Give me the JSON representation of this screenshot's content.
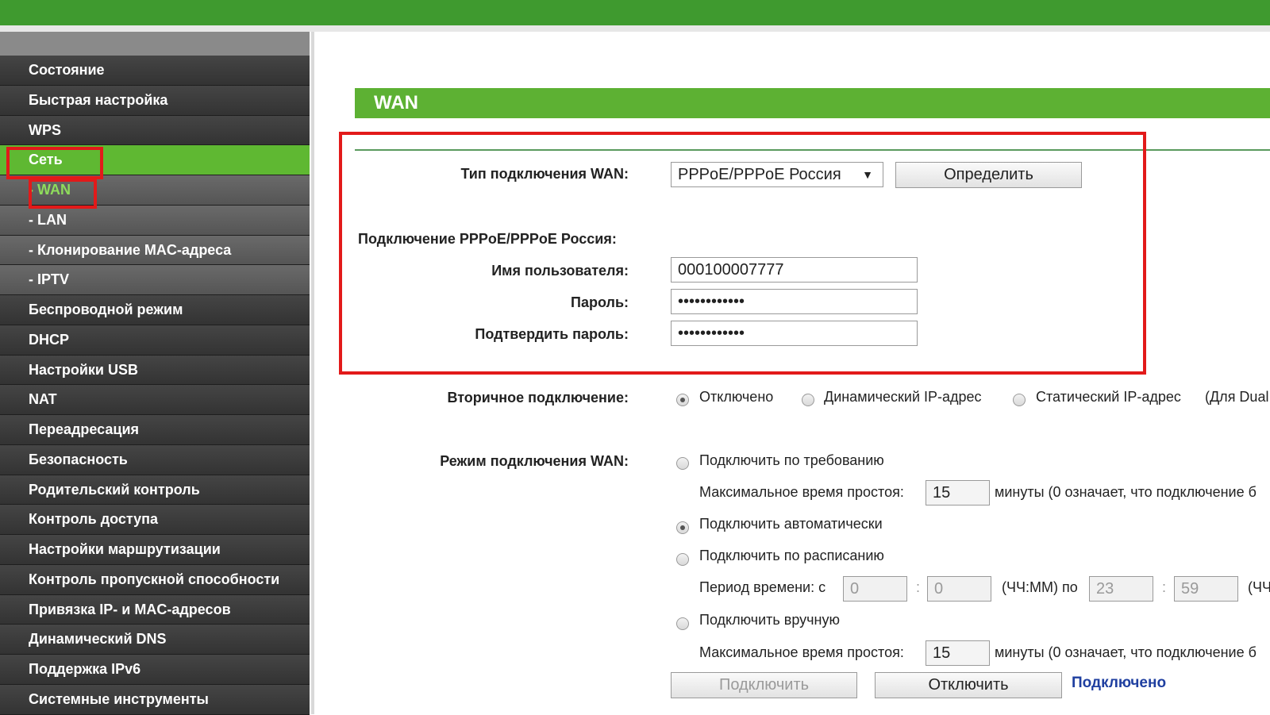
{
  "sidebar": {
    "items": [
      {
        "label": "Состояние"
      },
      {
        "label": "Быстрая настройка"
      },
      {
        "label": "WPS"
      },
      {
        "label": "Сеть"
      },
      {
        "label": "- WAN"
      },
      {
        "label": "- LAN"
      },
      {
        "label": "- Клонирование MAC-адреса"
      },
      {
        "label": "- IPTV"
      },
      {
        "label": "Беспроводной режим"
      },
      {
        "label": "DHCP"
      },
      {
        "label": "Настройки USB"
      },
      {
        "label": "NAT"
      },
      {
        "label": "Переадресация"
      },
      {
        "label": "Безопасность"
      },
      {
        "label": "Родительский контроль"
      },
      {
        "label": "Контроль доступа"
      },
      {
        "label": "Настройки маршрутизации"
      },
      {
        "label": "Контроль пропускной способности"
      },
      {
        "label": "Привязка IP- и MAC-адресов"
      },
      {
        "label": "Динамический DNS"
      },
      {
        "label": "Поддержка IPv6"
      },
      {
        "label": "Системные инструменты"
      }
    ],
    "active_index": 3,
    "current_sub_index": 4
  },
  "page": {
    "title": "WAN"
  },
  "wan": {
    "type_label": "Тип подключения WAN:",
    "type_value": "PPPoE/PPPoE Россия",
    "detect_button": "Определить",
    "pppoe_section": "Подключение PPPoE/PPPoE Россия:",
    "username_label": "Имя пользователя:",
    "username_value": "000100007777",
    "password_label": "Пароль:",
    "password_value": "••••••••••••",
    "confirm_label": "Подтвердить пароль:",
    "confirm_value": "••••••••••••"
  },
  "secondary": {
    "label": "Вторичное подключение:",
    "options": [
      "Отключено",
      "Динамический IP-адрес",
      "Статический IP-адрес",
      "(Для Dual"
    ],
    "selected": "Отключено"
  },
  "mode": {
    "label": "Режим подключения WAN:",
    "on_demand": "Подключить по требованию",
    "idle_label": "Максимальное время простоя:",
    "idle_value": "15",
    "idle_note": "минуты (0 означает, что подключение б",
    "auto": "Подключить автоматически",
    "schedule": "Подключить по расписанию",
    "period_label": "Период времени: с",
    "from_h": "0",
    "from_m": "0",
    "hhmm_to": "(ЧЧ:ММ) по",
    "to_h": "23",
    "to_m": "59",
    "hhmm_tail": "(ЧЧ",
    "colon": ":",
    "manual": "Подключить вручную",
    "idle_label2": "Максимальное время простоя:",
    "idle_value2": "15",
    "idle_note2": "минуты (0 означает, что подключение б",
    "selected": "Подключить автоматически"
  },
  "actions": {
    "connect": "Подключить",
    "disconnect": "Отключить",
    "status": "Подключено"
  },
  "colors": {
    "accent_green": "#5db133",
    "highlight_red": "#e21a1a",
    "status_blue": "#1f3fa0"
  }
}
